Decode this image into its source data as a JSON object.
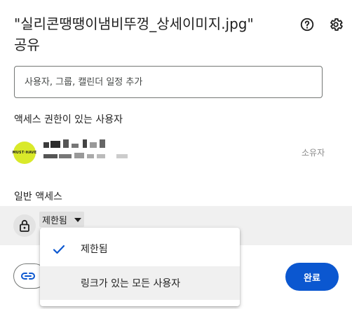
{
  "dialog": {
    "title": "\"실리콘땡땡이냄비뚜껑_상세이미지.jpg\"",
    "title_line2": "공유",
    "help_icon": "help-circle-icon",
    "settings_icon": "gear-icon"
  },
  "add_people": {
    "placeholder": "사용자, 그룹, 캘린더 일정 추가"
  },
  "people_with_access": {
    "label": "액세스 권한이 있는 사용자",
    "users": [
      {
        "avatar_text": "MUST·HAVE",
        "role": "소유자"
      }
    ]
  },
  "general_access": {
    "label": "일반 액세스",
    "selected": "제한됨",
    "lock_icon": "lock-icon",
    "options": [
      {
        "label": "제한됨",
        "checked": true
      },
      {
        "label": "링크가 있는 모든 사용자",
        "checked": false
      }
    ]
  },
  "footer": {
    "copy_link_icon": "link-icon",
    "done_label": "완료"
  },
  "colors": {
    "primary": "#0b57d0",
    "avatar_bg": "#d9e92a",
    "band_bg": "#f0f0f0"
  }
}
